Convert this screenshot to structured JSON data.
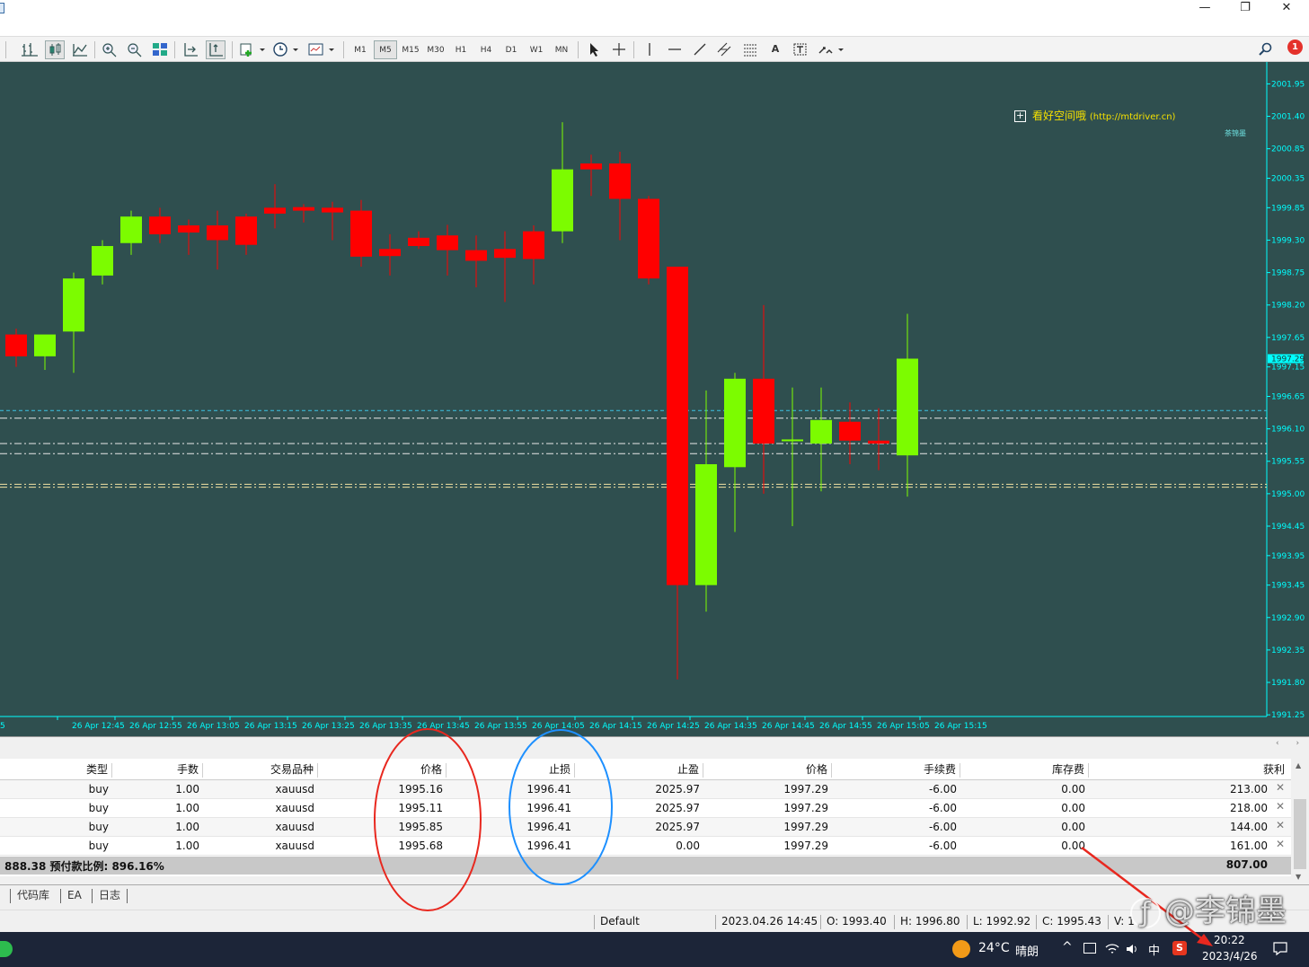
{
  "window": {
    "controls": {
      "minimize": "—",
      "restore": "❐",
      "close": "✕"
    },
    "mdi_controls": {
      "minimize": "–",
      "restore": "❐",
      "close": "✕"
    }
  },
  "toolbar": {
    "timeframes": [
      "M1",
      "M5",
      "M15",
      "M30",
      "H1",
      "H4",
      "D1",
      "W1",
      "MN"
    ],
    "active_timeframe": "M5",
    "text_tool_label": "A",
    "notification_count": "1"
  },
  "chart": {
    "watermark_title": "看好空间哦",
    "watermark_url": "(http://mtdriver.cn)",
    "corner_label": "茶锦墨",
    "current_price_tag": "1997.29",
    "colors": {
      "background": "#2f4f4f",
      "bull": "#7cfc00",
      "bear": "#ff0000",
      "axis": "#00ffff"
    }
  },
  "chart_data": {
    "type": "candlestick",
    "instrument": "xauusd",
    "timeframe": "M5",
    "ylim": [
      1991.1,
      2002.2
    ],
    "y_ticks": [
      "2001.95",
      "2001.40",
      "2000.85",
      "2000.35",
      "1999.85",
      "1999.30",
      "1998.75",
      "1998.20",
      "1997.65",
      "1997.15",
      "1996.65",
      "1996.10",
      "1995.55",
      "1995.00",
      "1994.45",
      "1993.95",
      "1993.45",
      "1992.90",
      "1992.35",
      "1991.80",
      "1991.25"
    ],
    "x_ticks": [
      "26 Apr 12:45",
      "26 Apr 12:55",
      "26 Apr 13:05",
      "26 Apr 13:15",
      "26 Apr 13:25",
      "26 Apr 13:35",
      "26 Apr 13:45",
      "26 Apr 13:55",
      "26 Apr 14:05",
      "26 Apr 14:15",
      "26 Apr 14:25",
      "26 Apr 14:35",
      "26 Apr 14:45",
      "26 Apr 14:55",
      "26 Apr 15:05",
      "26 Apr 15:15"
    ],
    "x_tick_left_partial": "5",
    "candles": [
      {
        "o": 1997.7,
        "h": 1997.8,
        "l": 1997.15,
        "c": 1997.33
      },
      {
        "o": 1997.33,
        "h": 1997.55,
        "l": 1997.1,
        "c": 1997.7
      },
      {
        "o": 1997.75,
        "h": 1998.75,
        "l": 1997.05,
        "c": 1998.65
      },
      {
        "o": 1998.7,
        "h": 1999.3,
        "l": 1998.55,
        "c": 1999.2
      },
      {
        "o": 1999.25,
        "h": 1999.8,
        "l": 1999.05,
        "c": 1999.7
      },
      {
        "o": 1999.7,
        "h": 1999.85,
        "l": 1999.25,
        "c": 1999.4
      },
      {
        "o": 1999.55,
        "h": 1999.65,
        "l": 1999.05,
        "c": 1999.43
      },
      {
        "o": 1999.55,
        "h": 1999.8,
        "l": 1998.8,
        "c": 1999.3
      },
      {
        "o": 1999.7,
        "h": 1999.75,
        "l": 1999.05,
        "c": 1999.22
      },
      {
        "o": 1999.85,
        "h": 2000.25,
        "l": 1999.5,
        "c": 1999.75
      },
      {
        "o": 1999.86,
        "h": 1999.91,
        "l": 1999.6,
        "c": 1999.8
      },
      {
        "o": 1999.85,
        "h": 1999.95,
        "l": 1999.3,
        "c": 1999.77
      },
      {
        "o": 1999.8,
        "h": 1999.98,
        "l": 1998.85,
        "c": 1999.02
      },
      {
        "o": 1999.15,
        "h": 1999.4,
        "l": 1998.7,
        "c": 1999.03
      },
      {
        "o": 1999.34,
        "h": 1999.45,
        "l": 1999.15,
        "c": 1999.2
      },
      {
        "o": 1999.38,
        "h": 1999.56,
        "l": 1998.7,
        "c": 1999.13
      },
      {
        "o": 1999.13,
        "h": 1999.38,
        "l": 1998.5,
        "c": 1998.95
      },
      {
        "o": 1999.15,
        "h": 1999.45,
        "l": 1998.25,
        "c": 1999.0
      },
      {
        "o": 1999.45,
        "h": 1999.55,
        "l": 1998.55,
        "c": 1998.98
      },
      {
        "o": 1999.45,
        "h": 2001.3,
        "l": 1999.25,
        "c": 2000.5
      },
      {
        "o": 2000.6,
        "h": 2000.75,
        "l": 2000.05,
        "c": 2000.5
      },
      {
        "o": 2000.6,
        "h": 2000.8,
        "l": 1999.3,
        "c": 2000.0
      },
      {
        "o": 2000.0,
        "h": 2000.05,
        "l": 1998.55,
        "c": 1998.65
      },
      {
        "o": 1998.85,
        "h": 1998.85,
        "l": 1991.85,
        "c": 1993.45
      },
      {
        "o": 1993.45,
        "h": 1996.75,
        "l": 1993.0,
        "c": 1995.5
      },
      {
        "o": 1995.45,
        "h": 1997.05,
        "l": 1994.35,
        "c": 1996.95
      },
      {
        "o": 1996.95,
        "h": 1998.2,
        "l": 1995.0,
        "c": 1995.85
      },
      {
        "o": 1995.9,
        "h": 1996.8,
        "l": 1994.45,
        "c": 1995.92
      },
      {
        "o": 1995.85,
        "h": 1996.8,
        "l": 1995.04,
        "c": 1996.25
      },
      {
        "o": 1996.22,
        "h": 1996.55,
        "l": 1995.5,
        "c": 1995.9
      },
      {
        "o": 1995.9,
        "h": 1996.45,
        "l": 1995.4,
        "c": 1995.85
      },
      {
        "o": 1995.65,
        "h": 1998.05,
        "l": 1994.95,
        "c": 1997.29
      }
    ],
    "horizontal_lines": [
      1996.41,
      1996.28,
      1995.85,
      1995.68,
      1995.16,
      1995.11
    ]
  },
  "orders": {
    "columns": [
      "类型",
      "手数",
      "交易品种",
      "价格",
      "止损",
      "止盈",
      "价格",
      "手续费",
      "库存费",
      "获利"
    ],
    "rows": [
      [
        "buy",
        "1.00",
        "xauusd",
        "1995.16",
        "1996.41",
        "2025.97",
        "1997.29",
        "-6.00",
        "0.00",
        "213.00"
      ],
      [
        "buy",
        "1.00",
        "xauusd",
        "1995.11",
        "1996.41",
        "2025.97",
        "1997.29",
        "-6.00",
        "0.00",
        "218.00"
      ],
      [
        "buy",
        "1.00",
        "xauusd",
        "1995.85",
        "1996.41",
        "2025.97",
        "1997.29",
        "-6.00",
        "0.00",
        "144.00"
      ],
      [
        "buy",
        "1.00",
        "xauusd",
        "1995.68",
        "1996.41",
        "0.00",
        "1997.29",
        "-6.00",
        "0.00",
        "161.00"
      ]
    ],
    "close_glyph": "✕",
    "summary_left": "888.38  预付款比例: 896.16%",
    "summary_total": "807.00"
  },
  "bottom_tabs": [
    "代码库",
    "EA",
    "日志"
  ],
  "status_bar": {
    "profile": "Default",
    "datetime": "2023.04.26 14:45",
    "open": "O: 1993.40",
    "high": "H: 1996.80",
    "low": "L: 1992.92",
    "close": "C: 1995.43",
    "volume": "V: 1"
  },
  "taskbar": {
    "weather_temp": "24°C",
    "weather_desc": "晴朗",
    "ime": "中",
    "time": "20:22",
    "date": "2023/4/26"
  },
  "annotation_watermark": "@李锦墨"
}
